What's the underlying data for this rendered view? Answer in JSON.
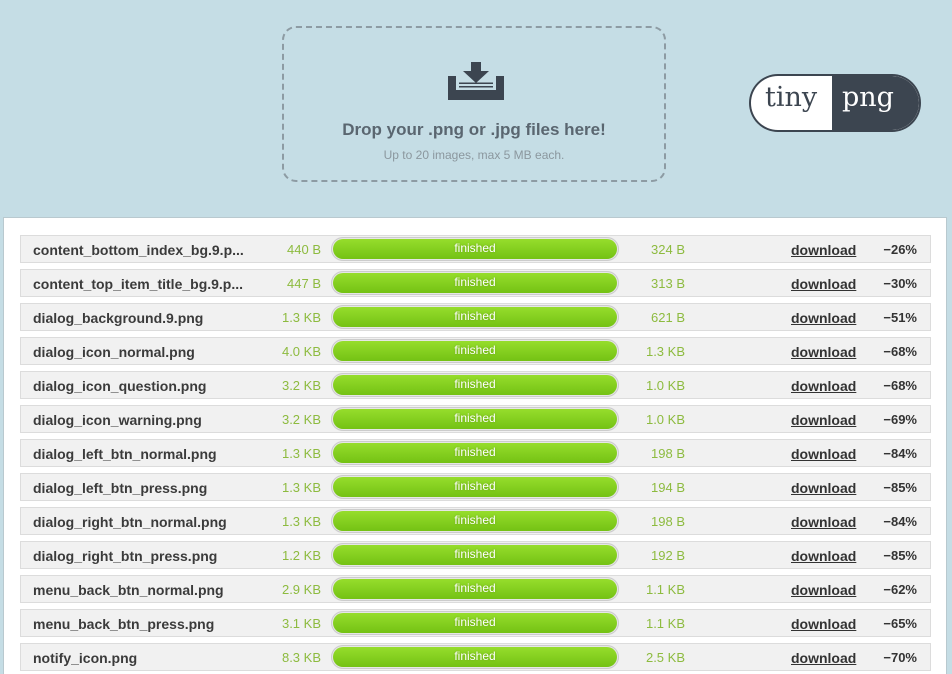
{
  "dropzone": {
    "icon": "download-tray-icon",
    "title": "Drop your .png or .jpg files here!",
    "subtitle": "Up to 20 images, max 5 MB each."
  },
  "logo": {
    "left_text": "tiny",
    "right_text": "png"
  },
  "colors": {
    "background": "#c5dde5",
    "progress_green": "#83cf1f",
    "size_green": "#8dbb3f",
    "logo_dark": "#3c4550"
  },
  "files": [
    {
      "name": "content_bottom_index_bg.9.p...",
      "original_size": "440 B",
      "status": "finished",
      "progress": 1.0,
      "new_size": "324 B",
      "download": "download",
      "savings": "−26%"
    },
    {
      "name": "content_top_item_title_bg.9.p...",
      "original_size": "447 B",
      "status": "finished",
      "progress": 1.0,
      "new_size": "313 B",
      "download": "download",
      "savings": "−30%"
    },
    {
      "name": "dialog_background.9.png",
      "original_size": "1.3 KB",
      "status": "finished",
      "progress": 1.0,
      "new_size": "621 B",
      "download": "download",
      "savings": "−51%"
    },
    {
      "name": "dialog_icon_normal.png",
      "original_size": "4.0 KB",
      "status": "finished",
      "progress": 1.0,
      "new_size": "1.3 KB",
      "download": "download",
      "savings": "−68%"
    },
    {
      "name": "dialog_icon_question.png",
      "original_size": "3.2 KB",
      "status": "finished",
      "progress": 1.0,
      "new_size": "1.0 KB",
      "download": "download",
      "savings": "−68%"
    },
    {
      "name": "dialog_icon_warning.png",
      "original_size": "3.2 KB",
      "status": "finished",
      "progress": 1.0,
      "new_size": "1.0 KB",
      "download": "download",
      "savings": "−69%"
    },
    {
      "name": "dialog_left_btn_normal.png",
      "original_size": "1.3 KB",
      "status": "finished",
      "progress": 1.0,
      "new_size": "198 B",
      "download": "download",
      "savings": "−84%"
    },
    {
      "name": "dialog_left_btn_press.png",
      "original_size": "1.3 KB",
      "status": "finished",
      "progress": 1.0,
      "new_size": "194 B",
      "download": "download",
      "savings": "−85%"
    },
    {
      "name": "dialog_right_btn_normal.png",
      "original_size": "1.3 KB",
      "status": "finished",
      "progress": 1.0,
      "new_size": "198 B",
      "download": "download",
      "savings": "−84%"
    },
    {
      "name": "dialog_right_btn_press.png",
      "original_size": "1.2 KB",
      "status": "finished",
      "progress": 1.0,
      "new_size": "192 B",
      "download": "download",
      "savings": "−85%"
    },
    {
      "name": "menu_back_btn_normal.png",
      "original_size": "2.9 KB",
      "status": "finished",
      "progress": 1.0,
      "new_size": "1.1 KB",
      "download": "download",
      "savings": "−62%"
    },
    {
      "name": "menu_back_btn_press.png",
      "original_size": "3.1 KB",
      "status": "finished",
      "progress": 1.0,
      "new_size": "1.1 KB",
      "download": "download",
      "savings": "−65%"
    },
    {
      "name": "notify_icon.png",
      "original_size": "8.3 KB",
      "status": "finished",
      "progress": 1.0,
      "new_size": "2.5 KB",
      "download": "download",
      "savings": "−70%"
    }
  ]
}
